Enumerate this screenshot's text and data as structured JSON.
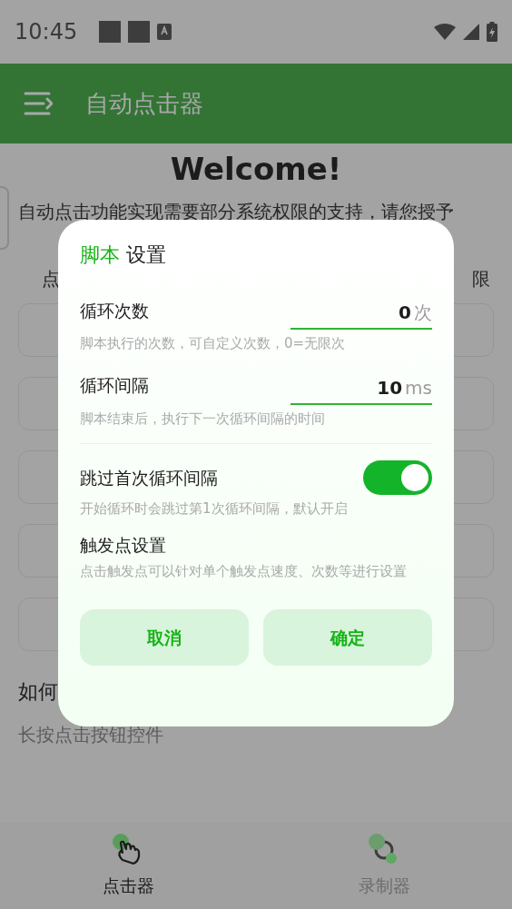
{
  "status_bar": {
    "time": "10:45"
  },
  "app_bar": {
    "title": "自动点击器"
  },
  "page": {
    "heading": "Welcome!",
    "intro": "自动点击功能实现需要部分系统权限的支持，请您授予",
    "fragment_left": "点",
    "fragment_right": "限",
    "how_to_heading": "如何",
    "how_to_text": "长按点击按钮控件"
  },
  "dialog": {
    "title_accent": "脚本",
    "title": "设置",
    "settings": [
      {
        "kind": "number",
        "label": "循环次数",
        "value": "0",
        "unit": "次",
        "description": "脚本执行的次数，可自定义次数，0=无限次"
      },
      {
        "kind": "number",
        "label": "循环间隔",
        "value": "10",
        "unit": "ms",
        "description": "脚本结束后，执行下一次循环间隔的时间"
      },
      {
        "kind": "switch",
        "label": "跳过首次循环间隔",
        "on": true,
        "description": "开始循环时会跳过第1次循环间隔，默认开启"
      },
      {
        "kind": "link",
        "label": "触发点设置",
        "description": "点击触发点可以针对单个触发点速度、次数等进行设置"
      }
    ],
    "buttons": [
      "取消",
      "确定"
    ]
  },
  "bottom_nav": [
    {
      "label": "点击器",
      "selected": true
    },
    {
      "label": "录制器",
      "selected": false
    }
  ]
}
